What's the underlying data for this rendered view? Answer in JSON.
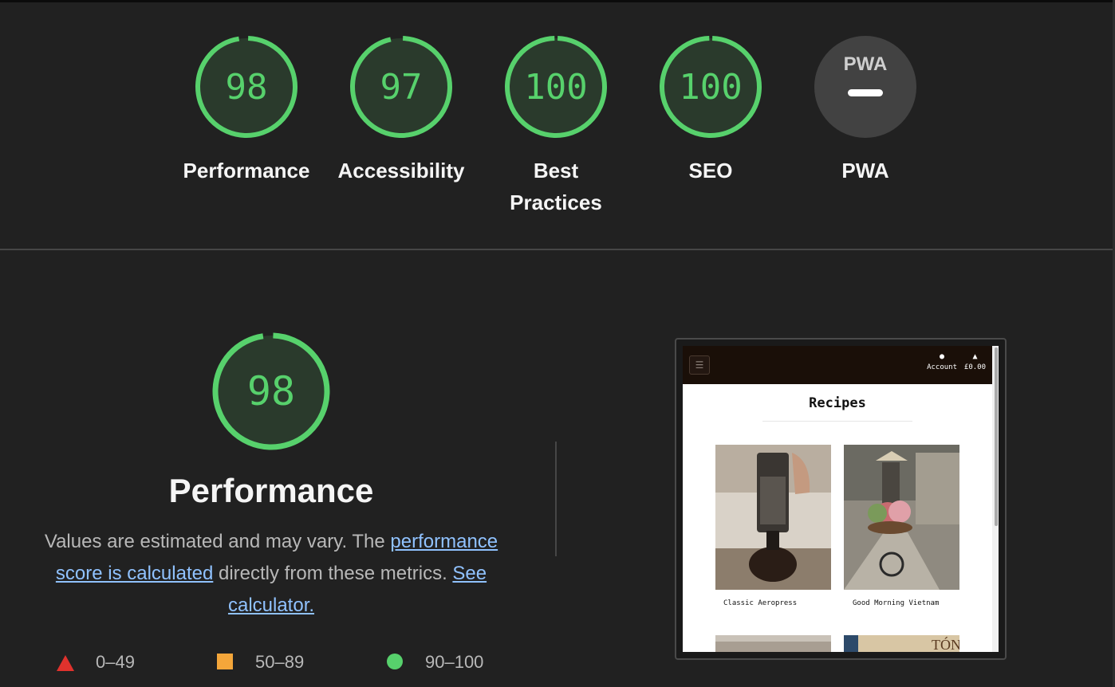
{
  "categories": [
    {
      "score": "98",
      "label": "Performance",
      "value": 98
    },
    {
      "score": "97",
      "label": "Accessibility",
      "value": 97
    },
    {
      "score": "100",
      "label": "Best Practices",
      "value": 100
    },
    {
      "score": "100",
      "label": "SEO",
      "value": 100
    },
    {
      "score": "",
      "label": "PWA",
      "badge": "PWA"
    }
  ],
  "performance": {
    "score": "98",
    "value": 98,
    "title": "Performance",
    "desc_prefix": "Values are estimated and may vary. The ",
    "link_score": "performance score is calculated",
    "desc_middle": " directly from these metrics. ",
    "link_calc": "See calculator."
  },
  "legend": {
    "fail": "0–49",
    "average": "50–89",
    "pass": "90–100"
  },
  "screenshot": {
    "nav": {
      "account": "Account",
      "cart": "£0.00",
      "menu_icon": "hamburger-icon"
    },
    "title": "Recipes",
    "cards": [
      {
        "caption": "Classic Aeropress"
      },
      {
        "caption": "Good Morning Vietnam"
      }
    ]
  },
  "colors": {
    "pass": "#57d16c",
    "average": "#f4a63a",
    "fail": "#e0322d",
    "link": "#90c2ff",
    "background": "#212121"
  }
}
